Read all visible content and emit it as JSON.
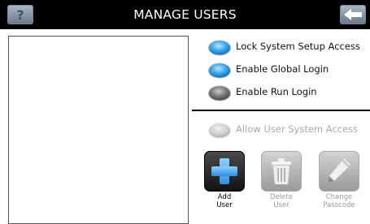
{
  "header": {
    "title": "MANAGE USERS",
    "help_icon": "question-mark-icon",
    "back_icon": "back-arrow-icon"
  },
  "user_list": {
    "items": []
  },
  "options": [
    {
      "label": "Lock System Setup Access",
      "state": "on",
      "color": "#3aa7ee"
    },
    {
      "label": "Enable Global Login",
      "state": "on",
      "color": "#3aa7ee"
    },
    {
      "label": "Enable Run Login",
      "state": "off",
      "color": "#6e6e6e"
    }
  ],
  "allow_access": {
    "label": "Allow User System Access",
    "state": "disabled"
  },
  "actions": {
    "add": {
      "label": "Add\nUser",
      "icon": "plus-icon",
      "enabled": true
    },
    "delete": {
      "label": "Delete\nUser",
      "icon": "trash-can-icon",
      "enabled": false
    },
    "change_passcode": {
      "label": "Change\nPasscode",
      "icon": "pencil-icon",
      "enabled": false
    }
  }
}
